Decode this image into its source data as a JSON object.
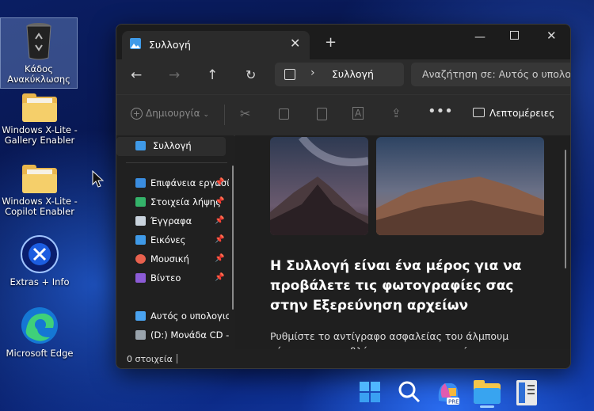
{
  "desktop": {
    "icons": [
      {
        "label": "Κάδος Ανακύκλωσης",
        "icon": "recycle-bin-icon"
      },
      {
        "label": "Windows X-Lite - Gallery Enabler",
        "icon": "folder-icon"
      },
      {
        "label": "Windows X-Lite - Copilot Enabler",
        "icon": "folder-icon"
      },
      {
        "label": "Extras + Info",
        "icon": "extras-icon"
      },
      {
        "label": "Microsoft Edge",
        "icon": "edge-icon"
      }
    ]
  },
  "window": {
    "tab_title": "Συλλογή",
    "address": "Συλλογή",
    "search_placeholder": "Αναζήτηση σε: Αυτός ο υπολογιστής",
    "new_label": "Δημιουργία",
    "details_label": "Λεπτομέρειες",
    "sidebar": {
      "gallery": "Συλλογή",
      "pinned": [
        {
          "label": "Επιφάνεια εργασίας",
          "icon": "desktop-icon",
          "color": "#3a8de0"
        },
        {
          "label": "Στοιχεία λήψης",
          "icon": "download-icon",
          "color": "#34b36a"
        },
        {
          "label": "Έγγραφα",
          "icon": "document-icon",
          "color": "#c9d3dd"
        },
        {
          "label": "Εικόνες",
          "icon": "pictures-icon",
          "color": "#3f9ae8"
        },
        {
          "label": "Μουσική",
          "icon": "music-icon",
          "color": "#e8614e"
        },
        {
          "label": "Βίντεο",
          "icon": "video-icon",
          "color": "#8c5bd6"
        }
      ],
      "this_pc": "Αυτός ο υπολογιστής",
      "cd_drive": "(D:) Μονάδα CD - "
    },
    "heading": "Η Συλλογή είναι ένα μέρος για να προβάλετε τις φωτογραφίες σας στην Εξερεύνηση αρχείων",
    "description": "Ρυθμίστε το αντίγραφο ασφαλείας του άλμπουμ κάμερας για να βλέπετε τις φωτογραφίες που",
    "status_count": "0 στοιχεία"
  },
  "colors": {
    "accent": "#3f9ae8",
    "taskbar_bg": "#0f2a7c"
  }
}
